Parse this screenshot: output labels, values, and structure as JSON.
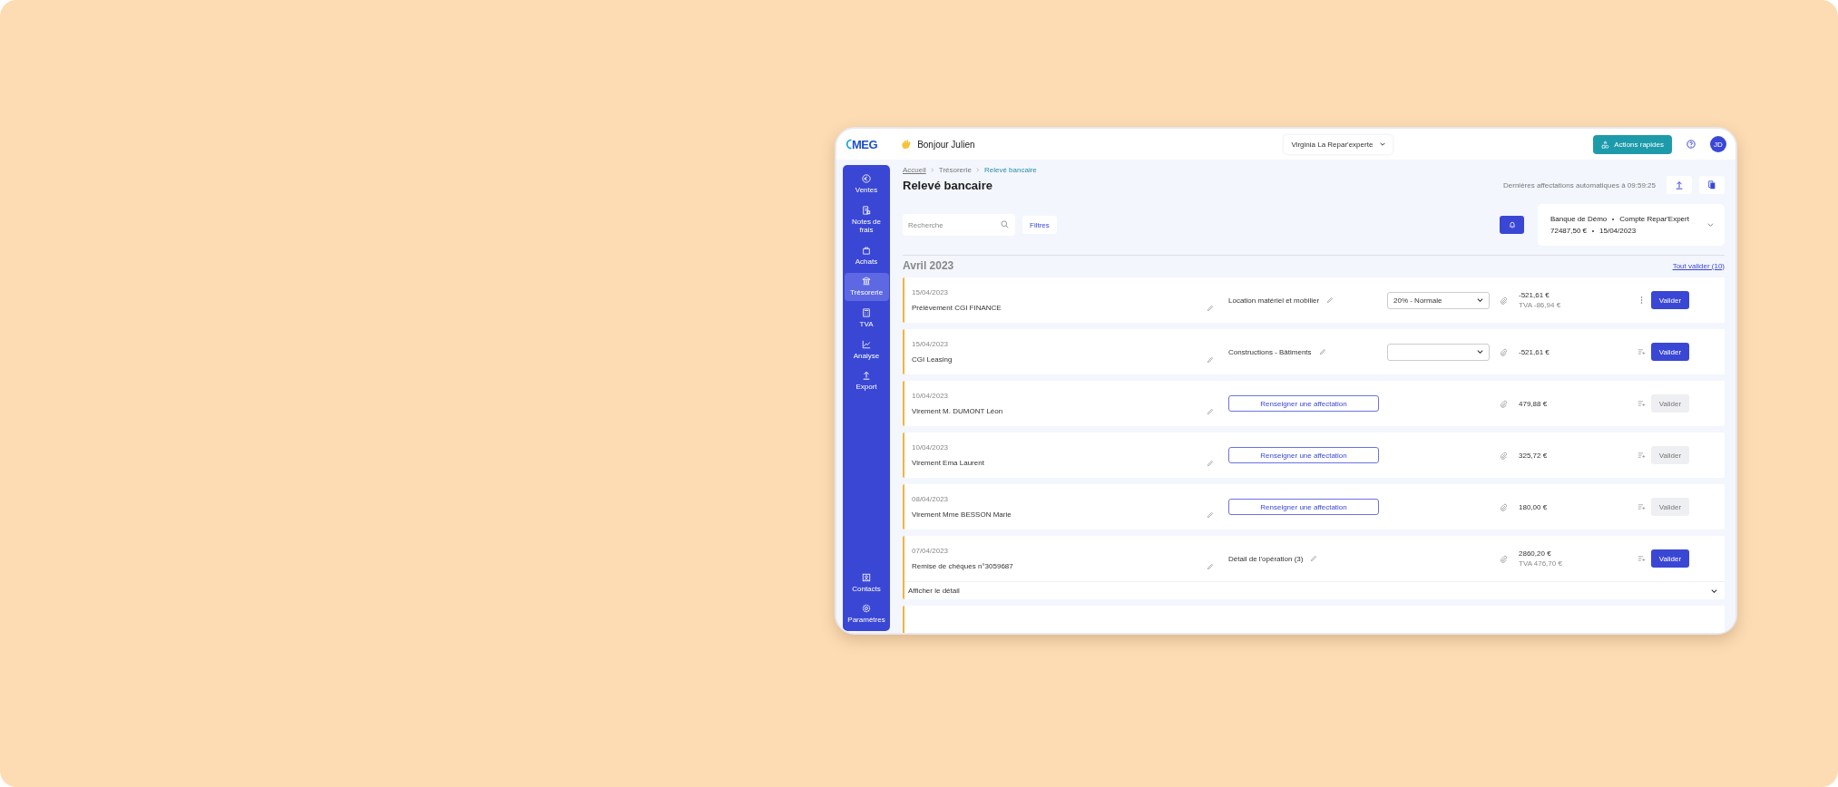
{
  "header": {
    "logo": "MEG",
    "greeting": "Bonjour Julien",
    "company": "Virginia La Repar'experte",
    "quick_actions": "Actions rapides",
    "avatar": "JD"
  },
  "sidebar": {
    "items": [
      {
        "label": "Ventes",
        "selected": false
      },
      {
        "label": "Notes de frais",
        "selected": false
      },
      {
        "label": "Achats",
        "selected": false
      },
      {
        "label": "Trésorerie",
        "selected": true
      },
      {
        "label": "TVA",
        "selected": false
      },
      {
        "label": "Analyse",
        "selected": false
      },
      {
        "label": "Export",
        "selected": false
      }
    ],
    "bottom_items": [
      {
        "label": "Contacts",
        "selected": false
      },
      {
        "label": "Paramètres",
        "selected": false
      }
    ]
  },
  "breadcrumb": [
    {
      "label": "Accueil",
      "current": false
    },
    {
      "label": "Trésorerie",
      "current": false
    },
    {
      "label": "Relevé bancaire",
      "current": true
    }
  ],
  "title": "Relevé bancaire",
  "last_sync": "Dernières affectations automatiques à 09:59:25",
  "search": {
    "placeholder": "Recherche"
  },
  "filters": "Filtres",
  "account": {
    "bank": "Banque de Démo",
    "name": "Compte Repar'Expert",
    "balance": "72487,50 €",
    "date": "15/04/2023"
  },
  "month": "Avril 2023",
  "validate_all": "Tout valider (10)",
  "rows": [
    {
      "kind": "categorized",
      "date": "15/04/2023",
      "label": "Prélèvement CGI FINANCE",
      "category": "Location matériel et mobilier",
      "vat": "20% - Normale",
      "amount": "-521,61 €",
      "vat_amount": "TVA -86,94 €",
      "has_menu": true,
      "validate": "Valider",
      "disabled": false
    },
    {
      "kind": "categorized",
      "date": "15/04/2023",
      "label": "CGI Leasing",
      "category": "Constructions - Bâtiments",
      "amount": "-521,61 €",
      "has_menu": false,
      "validate": "Valider",
      "disabled": false
    },
    {
      "kind": "unassigned",
      "date": "10/04/2023",
      "label": "Virement M. DUMONT Léon",
      "assign": "Renseigner une affectation",
      "amount": "479,88 €",
      "has_menu": false,
      "validate": "Valider",
      "disabled": true
    },
    {
      "kind": "unassigned",
      "date": "10/04/2023",
      "label": "Virement Ema Laurent",
      "assign": "Renseigner une affectation",
      "amount": "325,72 €",
      "has_menu": false,
      "validate": "Valider",
      "disabled": true
    },
    {
      "kind": "unassigned",
      "date": "08/04/2023",
      "label": "Virement Mme BESSON Marie",
      "assign": "Renseigner une affectation",
      "amount": "180,00 €",
      "has_menu": false,
      "validate": "Valider",
      "disabled": true
    },
    {
      "kind": "split",
      "date": "07/04/2023",
      "label": "Remise de chèques n°3059687",
      "category": "Détail de l'opération (3)",
      "amount": "2860,20 €",
      "vat_amount": "TVA 476,70 €",
      "has_menu": false,
      "validate": "Valider",
      "disabled": false,
      "detail": "Afficher le détail"
    }
  ]
}
